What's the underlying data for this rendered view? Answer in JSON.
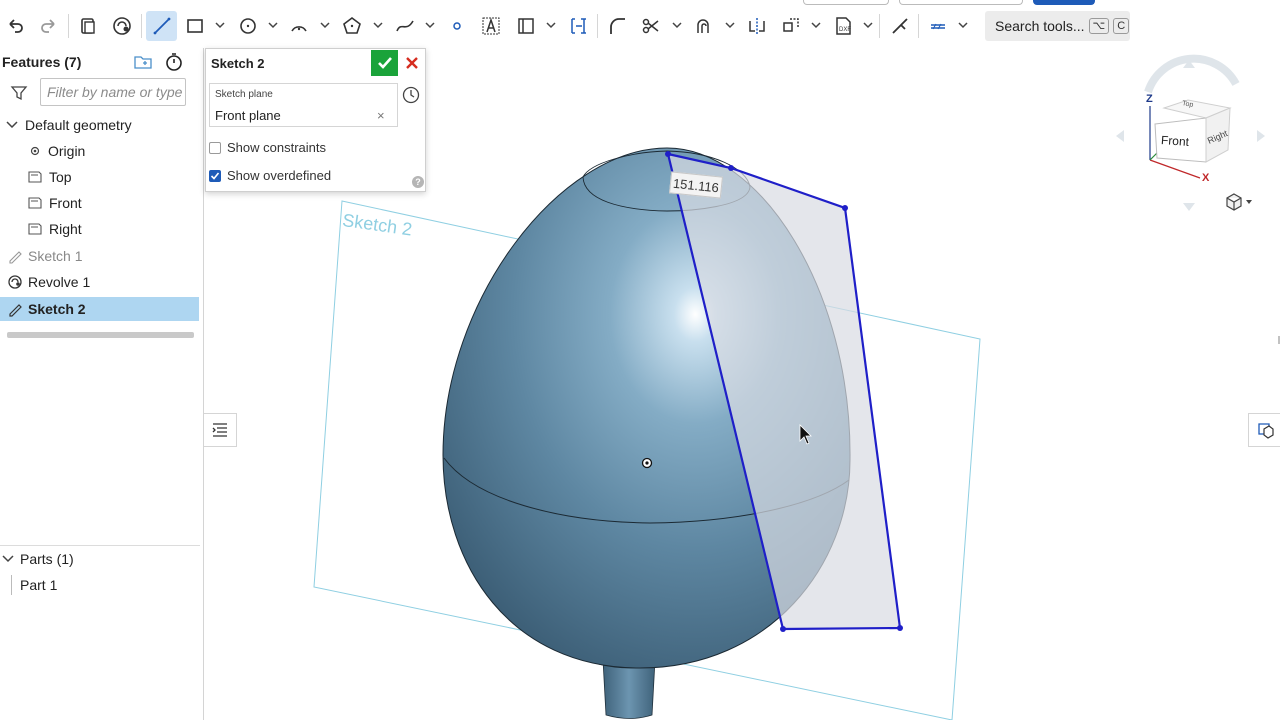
{
  "toolbar": {
    "search_label": "Search tools...",
    "search_shortcut_1": "⌥",
    "search_shortcut_2": "C"
  },
  "feature_panel": {
    "title": "Features (7)",
    "filter_placeholder": "Filter by name or type",
    "default_geometry_label": "Default geometry",
    "items": [
      {
        "label": "Origin"
      },
      {
        "label": "Top"
      },
      {
        "label": "Front"
      },
      {
        "label": "Right"
      },
      {
        "label": "Sketch 1"
      },
      {
        "label": "Revolve 1"
      },
      {
        "label": "Sketch 2"
      }
    ],
    "parts_header": "Parts (1)",
    "parts": [
      {
        "label": "Part 1"
      }
    ]
  },
  "sketch_dialog": {
    "title": "Sketch 2",
    "plane_label": "Sketch plane",
    "plane_value": "Front plane",
    "plane_clear": "×",
    "show_constraints_label": "Show constraints",
    "show_constraints_checked": false,
    "show_overdefined_label": "Show overdefined",
    "show_overdefined_checked": true,
    "help": "?"
  },
  "viewport": {
    "dimension_value": "151.116",
    "sketch_plane_label": "Sketch 2",
    "view_cube": {
      "face_front": "Front",
      "face_right": "Right",
      "face_top": "Top",
      "axis_z": "Z",
      "axis_x": "X"
    }
  },
  "colors": {
    "accent": "#1e5bb8",
    "selection": "#aed6f1",
    "accept": "#1aa33a",
    "cancel": "#d62d20",
    "sketch_line": "#1f1fc8",
    "plane_outline": "#8fcfe2",
    "body": "#5e8aa5"
  }
}
